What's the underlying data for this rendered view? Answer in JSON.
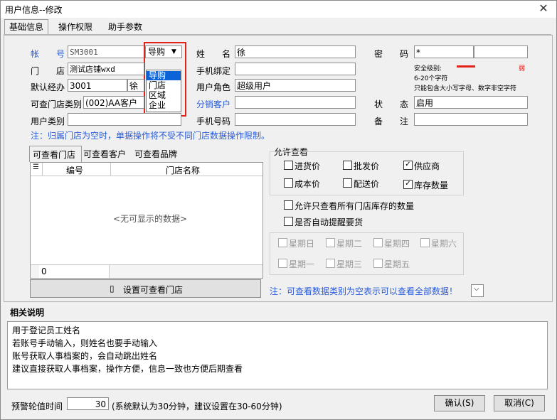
{
  "window": {
    "title": "用户信息--修改",
    "close_glyph": "✕"
  },
  "tabs": [
    "基础信息",
    "操作权限",
    "助手参数"
  ],
  "form": {
    "account_label": "帐　　号",
    "account_value": "SM3001",
    "type_value": "导购",
    "store_label": "门　　店",
    "store_value": "测试店铺wxd",
    "default_handler_label": "默认经办",
    "default_handler_value": "3001",
    "default_handler_name": "徐",
    "viewable_store_type_label": "可查门店类别",
    "viewable_store_type_value": "(002)AA客户",
    "user_category_label": "用户类别",
    "name_label": "姓　　名",
    "name_value": "徐",
    "phone_bind_label": "手机绑定",
    "user_role_label": "用户角色",
    "user_role_value": "超级用户",
    "distribution_customer_label": "分销客户",
    "phone_label": "手机号码",
    "password_label": "密　　码",
    "password_value": "*",
    "security_level_label": "安全级别:",
    "security_level_value": "弱",
    "password_rule_1": "6-20个字符",
    "password_rule_2": "只能包含大小写字母、数字非空字符",
    "status_label": "状　　态",
    "status_value": "启用",
    "remark_label": "备　　注"
  },
  "type_menu": {
    "options": [
      "导购",
      "门店",
      "区域",
      "企业"
    ],
    "selected": "导购"
  },
  "notes": {
    "store_note": "注：归属门店为空时，单据操作将不受不同门店数据操作限制。",
    "view_note": "注：可查看数据类别为空表示可以查看全部数据！"
  },
  "sub_tabs": [
    "可查看门店",
    "可查看客户",
    "可查看品牌"
  ],
  "grid": {
    "columns": [
      "编号",
      "门店名称"
    ],
    "empty_text": "<无可显示的数据>",
    "footer_count": "0"
  },
  "set_store_button": "设置可查看门店",
  "allow_view": {
    "title": "允许查看",
    "items": [
      {
        "label": "进货价",
        "checked": false
      },
      {
        "label": "批发价",
        "checked": false
      },
      {
        "label": "供应商",
        "checked": true
      },
      {
        "label": "成本价",
        "checked": false
      },
      {
        "label": "配送价",
        "checked": false
      },
      {
        "label": "库存数量",
        "checked": true
      }
    ]
  },
  "options": [
    {
      "label": "允许只查看所有门店库存的数量",
      "checked": false
    },
    {
      "label": "是否自动提醒要货",
      "checked": false
    }
  ],
  "weekdays": [
    "星期日",
    "星期二",
    "星期四",
    "星期六",
    "星期一",
    "星期三",
    "星期五"
  ],
  "description": {
    "title": "相关说明",
    "lines": [
      "用于登记员工姓名",
      "若账号手动输入，则姓名也要手动输入",
      "账号获取人事档案的，会自动跳出姓名",
      "建议直接获取人事档案，操作方便，信息一致也方便后期查看"
    ]
  },
  "footer": {
    "warn_label": "预警轮值时间",
    "warn_value": "30",
    "warn_hint": "(系统默认为30分钟，建议设置在30-60分钟)",
    "ok": "确认(S)",
    "cancel": "取消(C)"
  },
  "colors": {
    "accent": "#2a5bd7",
    "highlight": "#e2231a",
    "selected": "#0a64d8"
  }
}
